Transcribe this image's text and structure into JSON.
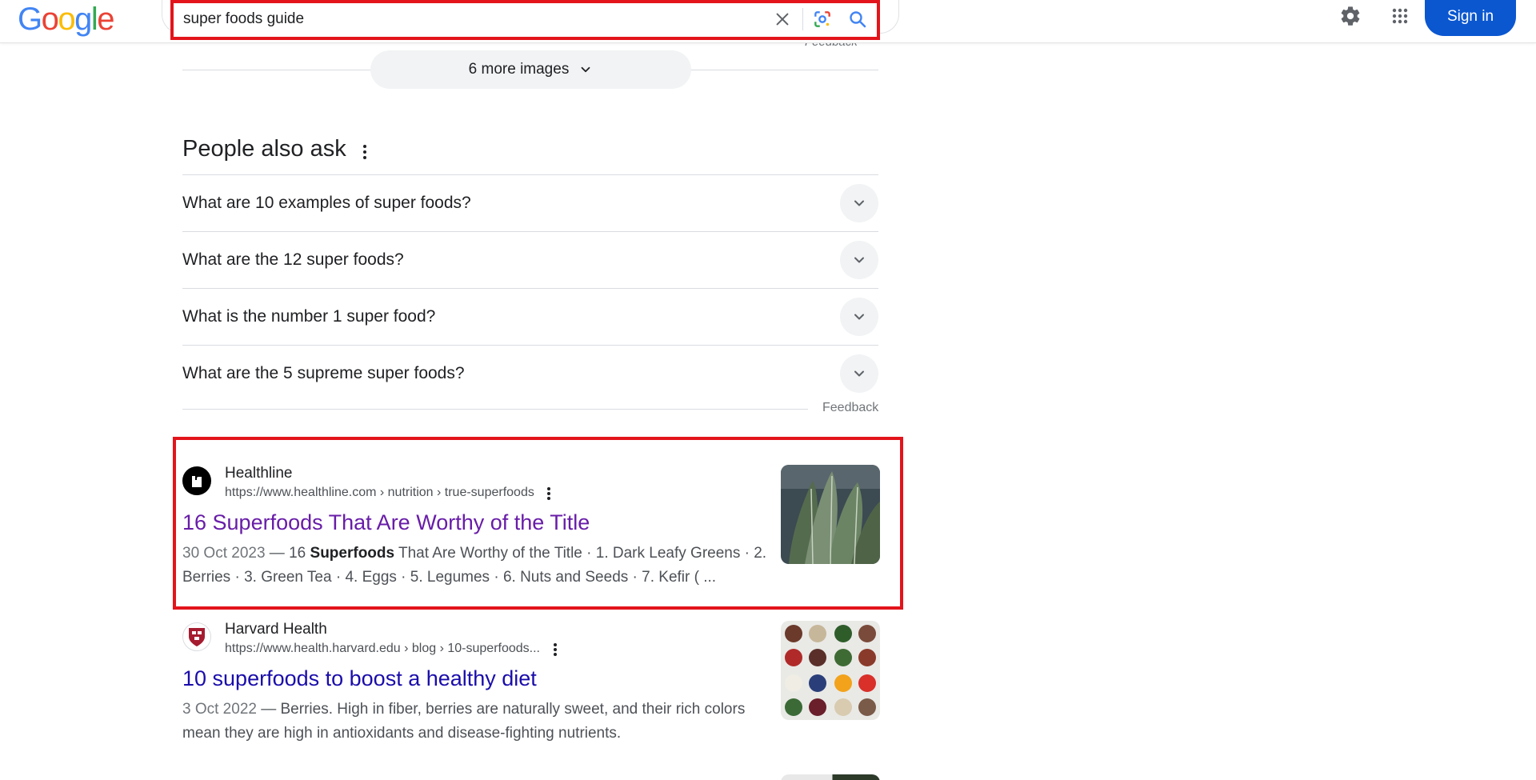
{
  "header": {
    "logo_letters": [
      "G",
      "o",
      "o",
      "g",
      "l",
      "e"
    ],
    "logo_colors": [
      "#4285F4",
      "#EA4335",
      "#FBBC05",
      "#4285F4",
      "#34A853",
      "#EA4335"
    ],
    "search_value": "super foods guide",
    "sign_in_label": "Sign in",
    "feedback_top": "Feedback"
  },
  "more_images": {
    "label": "6 more images"
  },
  "people_also_ask": {
    "title": "People also ask",
    "questions": [
      "What are 10 examples of super foods?",
      "What are the 12 super foods?",
      "What is the number 1 super food?",
      "What are the 5 supreme super foods?"
    ],
    "feedback": "Feedback"
  },
  "results": [
    {
      "site_name": "Healthline",
      "url": "https://www.healthline.com › nutrition › true-superfoods",
      "title": "16 Superfoods That Are Worthy of the Title",
      "title_color": "#681da8",
      "date": "30 Oct 2023",
      "snippet_pre": " — 16 ",
      "snippet_bold": "Superfoods",
      "snippet_post": " That Are Worthy of the Title · 1. Dark Leafy Greens · 2. Berries · 3. Green Tea · 4. Eggs · 5. Legumes · 6. Nuts and Seeds · 7. Kefir ( ..."
    },
    {
      "site_name": "Harvard Health",
      "url": "https://www.health.harvard.edu › blog › 10-superfoods...",
      "title": "10 superfoods to boost a healthy diet",
      "title_color": "#1a0dab",
      "date": "3 Oct 2022",
      "snippet_pre": " — Berries. High in fiber, berries are naturally sweet, and their rich colors mean they are high in antioxidants and disease-fighting nutrients.",
      "snippet_bold": "",
      "snippet_post": ""
    }
  ],
  "colors": {
    "highlight": "#e3141b",
    "sign_in_bg": "#0b57d0",
    "visited_link": "#681da8",
    "link": "#1a0dab"
  }
}
